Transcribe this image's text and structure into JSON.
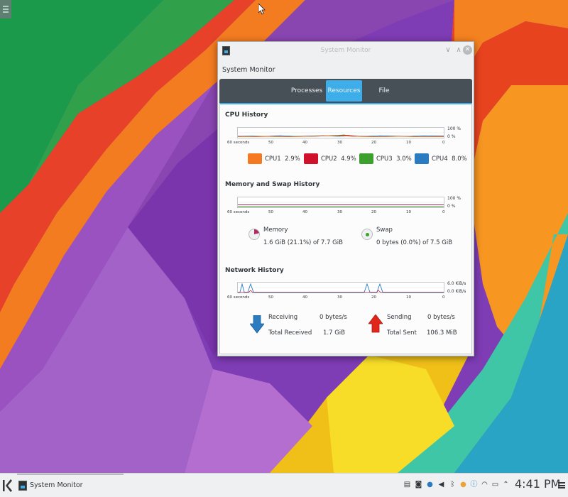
{
  "window": {
    "title": "System Monitor",
    "menu_label": "System Monitor",
    "controls": {
      "minimize": "∨",
      "maximize": "∧",
      "close": "✕"
    }
  },
  "tabs": [
    {
      "label": "Processes",
      "active": false
    },
    {
      "label": "Resources",
      "active": true
    },
    {
      "label": "File Systems",
      "active": false
    }
  ],
  "cpu": {
    "title": "CPU History",
    "top_label": "100 %",
    "bottom_label": "0 %",
    "axis": [
      "60 seconds",
      "50",
      "40",
      "30",
      "20",
      "10",
      "0"
    ],
    "legend": [
      {
        "name": "CPU1",
        "value": "2.9%",
        "color": "#f47920"
      },
      {
        "name": "CPU2",
        "value": "4.9%",
        "color": "#d0112b"
      },
      {
        "name": "CPU3",
        "value": "3.0%",
        "color": "#3d9f2e"
      },
      {
        "name": "CPU4",
        "value": "8.0%",
        "color": "#2a7bbf"
      }
    ]
  },
  "memory": {
    "title": "Memory and Swap History",
    "top_label": "100 %",
    "bottom_label": "0 %",
    "axis": [
      "60 seconds",
      "50",
      "40",
      "30",
      "20",
      "10",
      "0"
    ],
    "memory_label": "Memory",
    "memory_value": "1.6 GiB (21.1%) of 7.7 GiB",
    "memory_fraction": 0.211,
    "memory_color": "#b5285f",
    "swap_label": "Swap",
    "swap_value": "0 bytes (0.0%) of 7.5 GiB",
    "swap_fraction": 0.0,
    "swap_color": "#3d9f2e"
  },
  "network": {
    "title": "Network History",
    "top_label": "6.0 KiB/s",
    "bottom_label": "0.0 KiB/s",
    "axis": [
      "60 seconds",
      "50",
      "40",
      "30",
      "20",
      "10",
      "0"
    ],
    "receiving_label": "Receiving",
    "receiving_value": "0 bytes/s",
    "total_received_label": "Total Received",
    "total_received_value": "1.7 GiB",
    "sending_label": "Sending",
    "sending_value": "0 bytes/s",
    "total_sent_label": "Total Sent",
    "total_sent_value": "106.3 MiB",
    "receive_color": "#2a7bbf",
    "send_color": "#d0112b"
  },
  "taskbar": {
    "task_label": "System Monitor",
    "clock": "4:41 PM",
    "tray_icons": [
      "clipboard-icon",
      "kde-connect-icon",
      "bluetooth-app-icon",
      "volume-icon",
      "bluetooth-icon",
      "updates-icon",
      "info-icon",
      "network-icon",
      "battery-icon",
      "expand-icon"
    ]
  }
}
